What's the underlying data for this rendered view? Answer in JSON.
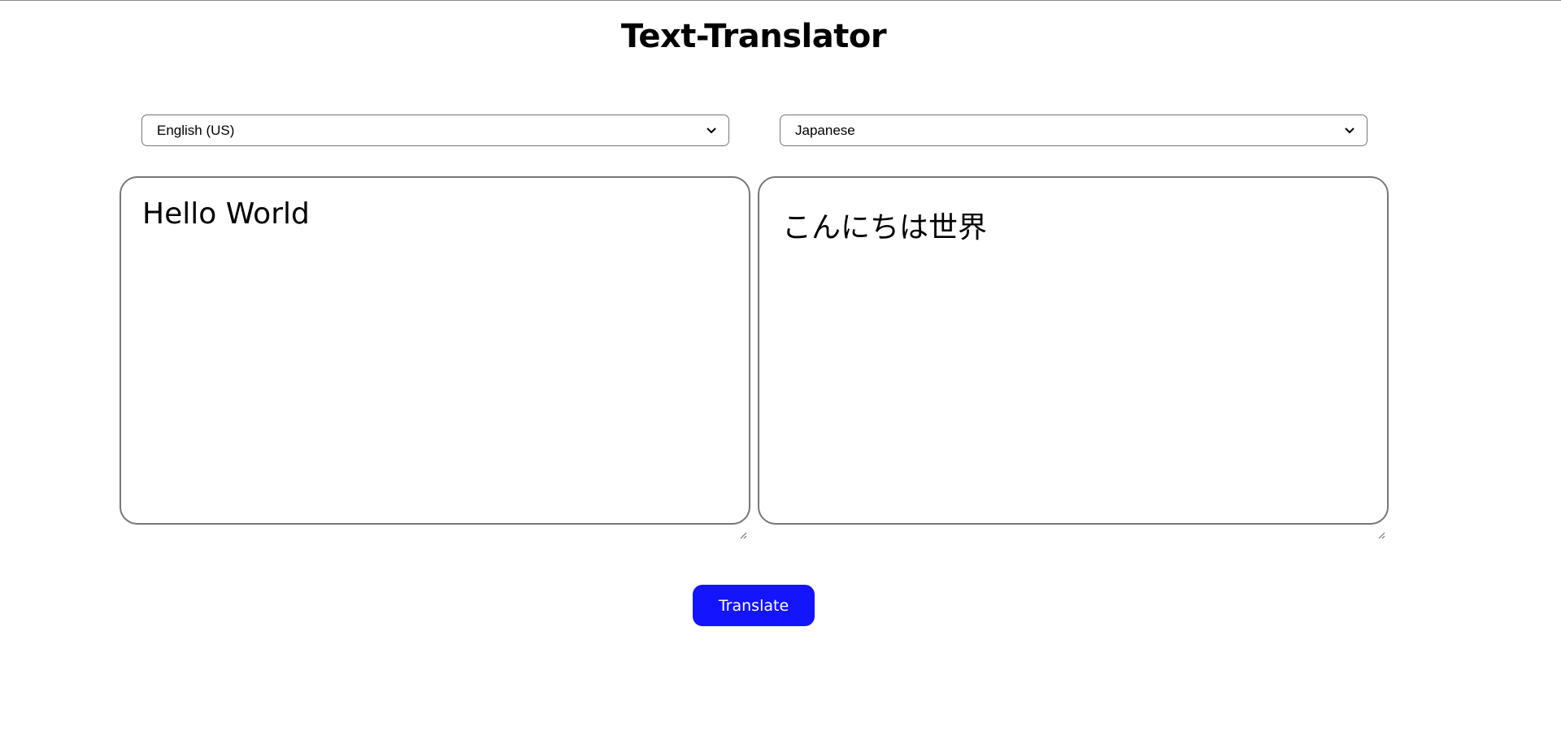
{
  "header": {
    "title": "Text-Translator"
  },
  "source": {
    "language": "English (US)",
    "text": "Hello World"
  },
  "target": {
    "language": "Japanese",
    "text": "こんにちは世界"
  },
  "actions": {
    "translate_label": "Translate"
  },
  "colors": {
    "button_bg": "#1414ff",
    "button_text": "#ffffff",
    "border": "#777777"
  },
  "icons": {
    "select_arrow": "chevron-down-icon",
    "resize": "resize-handle-icon"
  }
}
